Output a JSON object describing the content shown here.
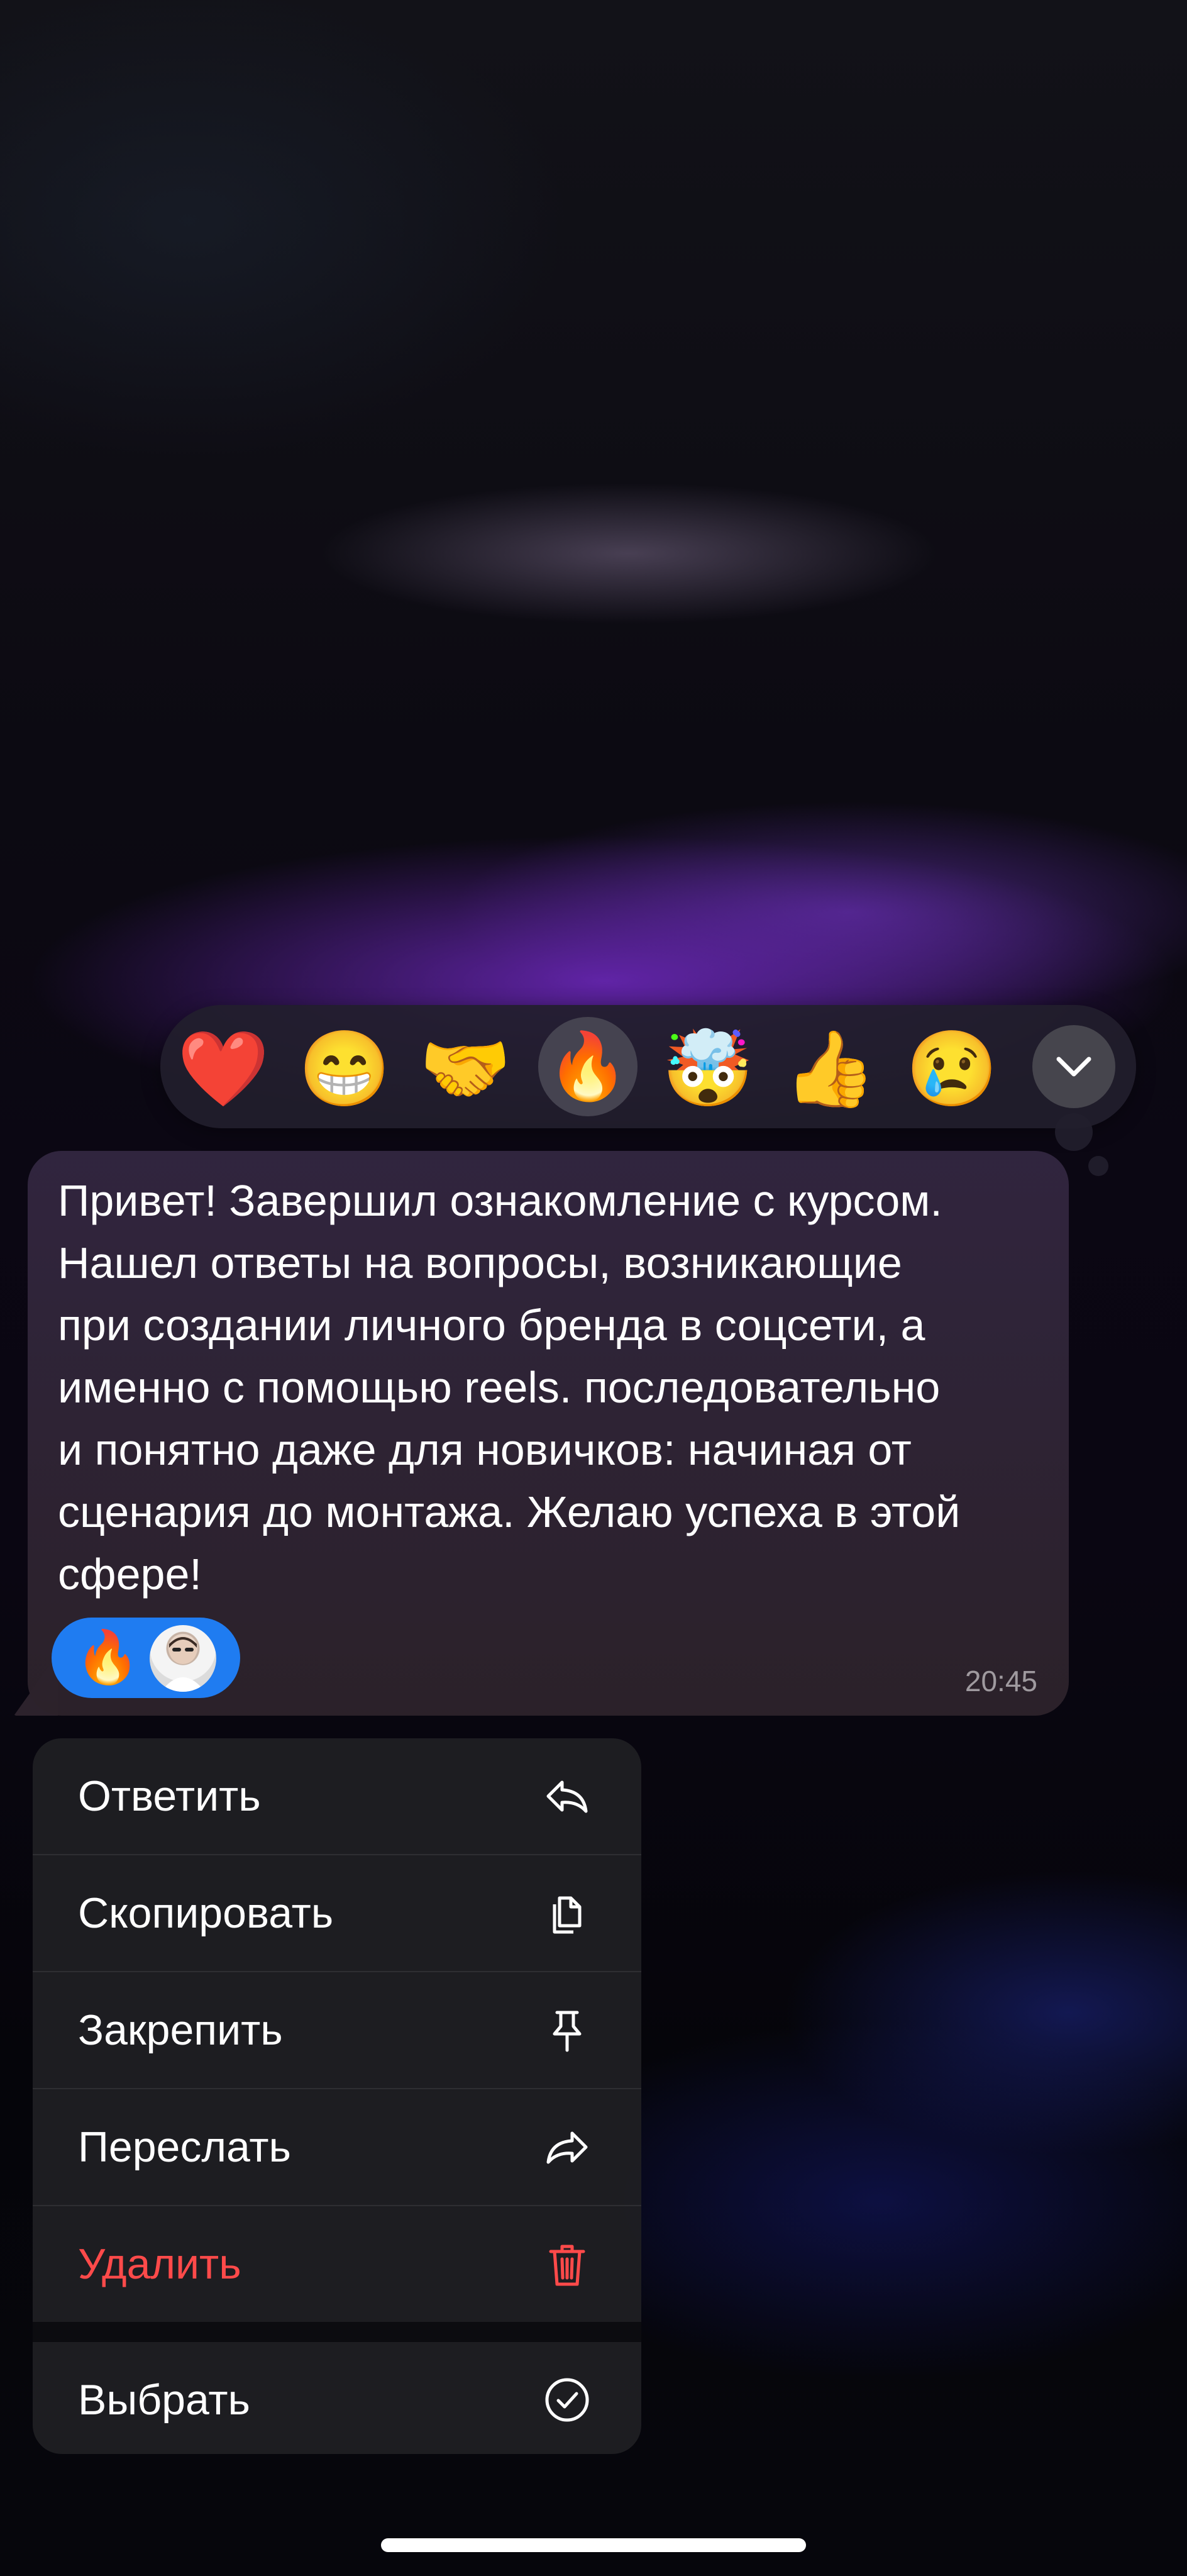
{
  "reactions": [
    {
      "icon": "red-heart",
      "glyph": "❤️"
    },
    {
      "icon": "grinning-face",
      "glyph": "😁"
    },
    {
      "icon": "handshake",
      "glyph": "🤝"
    },
    {
      "icon": "fire",
      "glyph": "🔥",
      "selected": true
    },
    {
      "icon": "exploding-head",
      "glyph": "🤯"
    },
    {
      "icon": "thumbs-up",
      "glyph": "👍"
    },
    {
      "icon": "crying-face",
      "glyph": "😢"
    }
  ],
  "expand_icon": "chevron-down-icon",
  "message": {
    "text": "Привет! Завершил ознакомление с курсом.\nНашел ответы на вопросы, возникающие\nпри создании личного бренда в соцсети, а\nименно с помощью reels. последовательно\nи понятно даже для новичков: начиная от\nсценария до монтажа. Желаю успеха в этой\nсфере!",
    "time": "20:45",
    "reaction": {
      "icon": "fire",
      "glyph": "🔥"
    },
    "bubble_color": "#2e2633"
  },
  "menu": {
    "items": [
      {
        "label": "Ответить",
        "icon": "reply-icon"
      },
      {
        "label": "Скопировать",
        "icon": "copy-icon"
      },
      {
        "label": "Закрепить",
        "icon": "pin-icon"
      },
      {
        "label": "Переслать",
        "icon": "forward-icon"
      },
      {
        "label": "Удалить",
        "icon": "trash-icon",
        "color": "#ff4a4a"
      },
      {
        "label": "Выбрать",
        "icon": "select-check-icon"
      }
    ]
  },
  "colors": {
    "accent": "#1f7cf1",
    "danger": "#ff4a4a"
  }
}
